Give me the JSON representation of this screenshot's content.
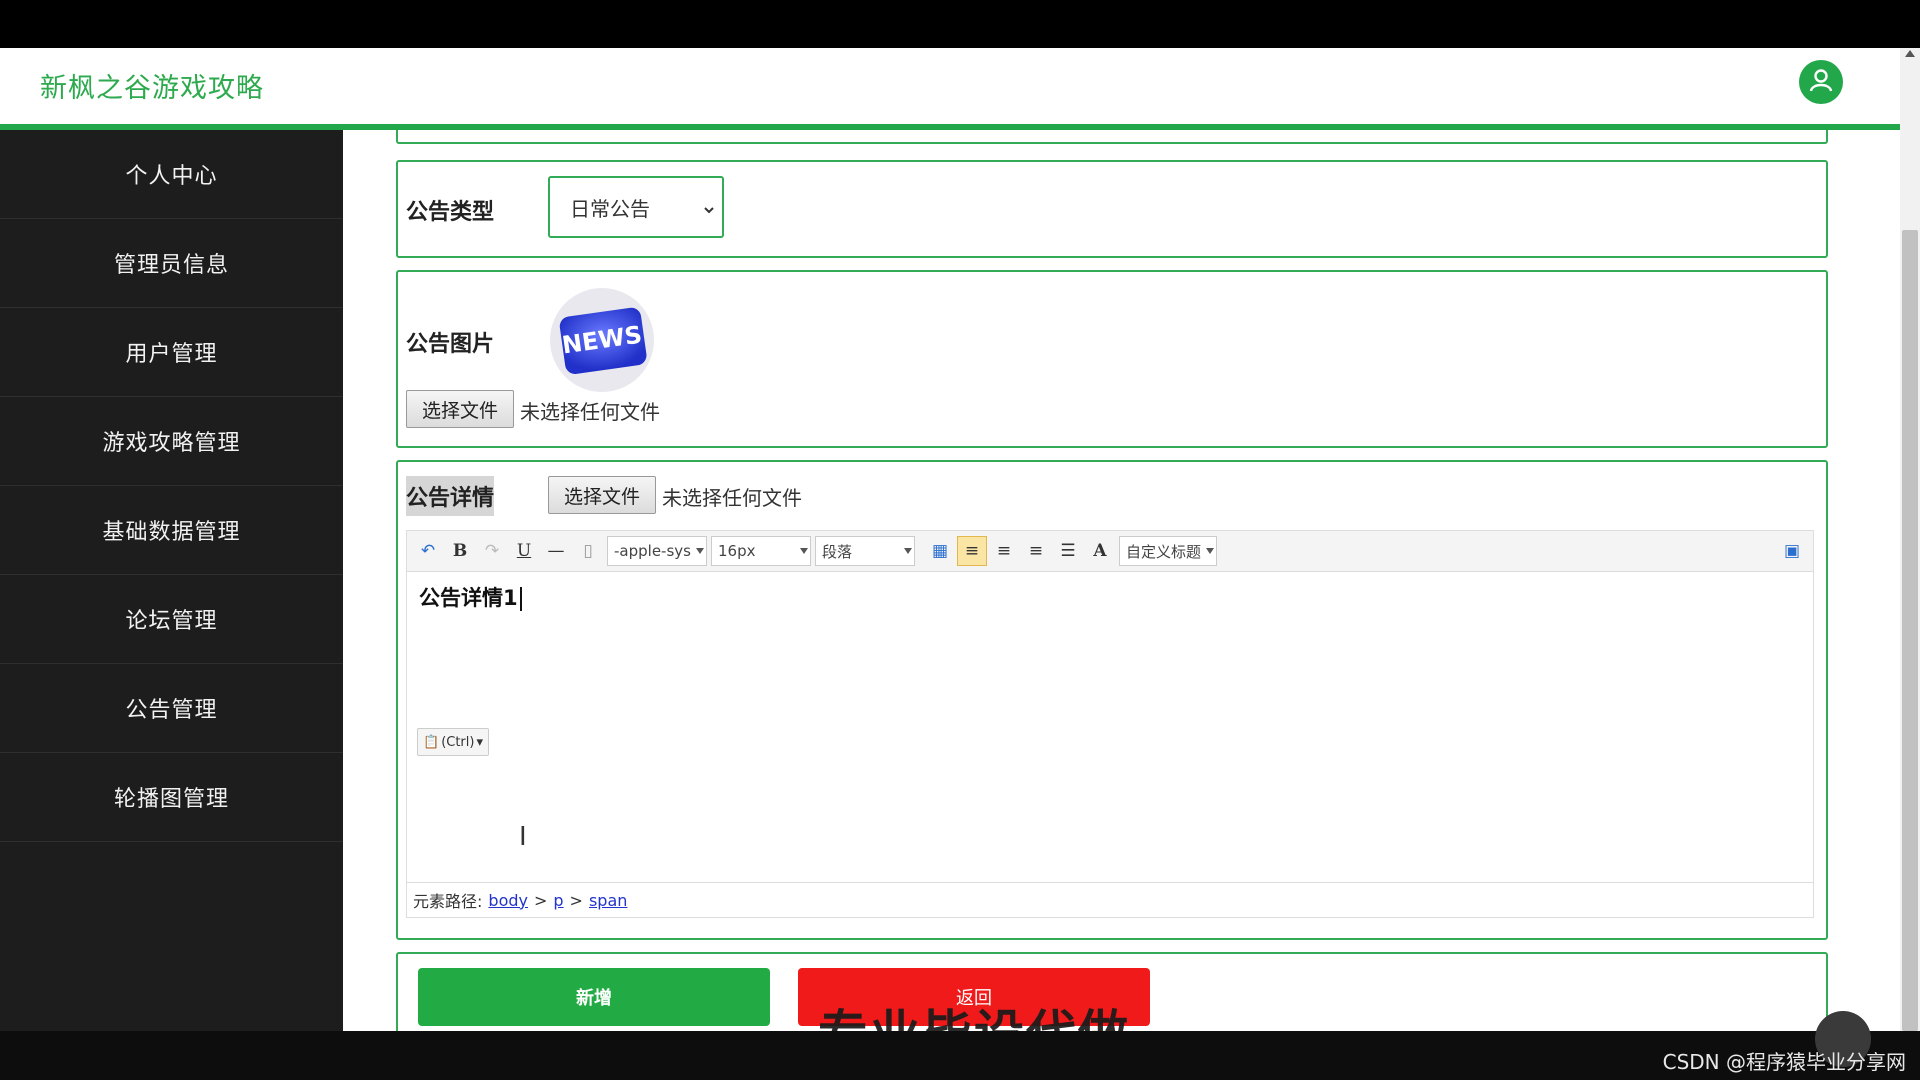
{
  "header": {
    "brand": "新枫之谷游戏攻略"
  },
  "sidebar": {
    "items": [
      {
        "label": "个人中心"
      },
      {
        "label": "管理员信息"
      },
      {
        "label": "用户管理"
      },
      {
        "label": "游戏攻略管理"
      },
      {
        "label": "基础数据管理"
      },
      {
        "label": "论坛管理"
      },
      {
        "label": "公告管理"
      },
      {
        "label": "轮播图管理"
      }
    ]
  },
  "form": {
    "type_label": "公告类型",
    "type_value": "日常公告",
    "image_label": "公告图片",
    "image_text": "NEWS",
    "image_file_button": "选择文件",
    "image_file_status": "未选择任何文件",
    "detail_label": "公告详情",
    "detail_file_button": "选择文件",
    "detail_file_status": "未选择任何文件"
  },
  "editor": {
    "font_family": "-apple-sys",
    "font_size": "16px",
    "paragraph": "段落",
    "custom_heading": "自定义标题",
    "content": "公告详情1",
    "paste_hint": "(Ctrl)",
    "path_label": "元素路径:",
    "path": [
      "body",
      "p",
      "span"
    ]
  },
  "actions": {
    "add_label": "新增",
    "back_label": "返回"
  },
  "overlay_text": "专业毕设代做",
  "credit": "CSDN @程序猿毕业分享网",
  "colors": {
    "accent": "#22a84a",
    "danger": "#f11a1a",
    "sidebar": "#1d1d1d"
  }
}
